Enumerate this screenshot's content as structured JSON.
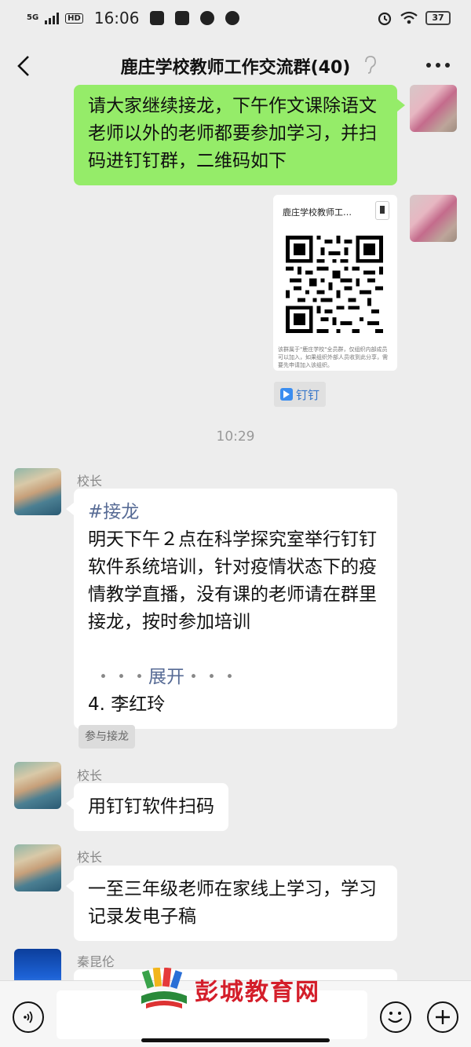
{
  "status_bar": {
    "network": "5G",
    "hd": "HD",
    "time": "16:06",
    "battery": "37"
  },
  "nav": {
    "title": "鹿庄学校教师工作交流群(40)"
  },
  "messages": {
    "m1_text": "请大家继续接龙，下午作文课除语文老师以外的老师都要参加学习，并扫码进钉钉群，二维码如下",
    "card": {
      "title": "鹿庄学校教师工…",
      "note": "该群属于\"鹿庄学校\"全员群，仅组织内部成员可以加入，如果组织外部人员收到此分享，需要先申请加入该组织。"
    },
    "app_tag": "钉钉",
    "time_1029": "10:29",
    "m3_sender": "校长",
    "m3_tag": "#接龙",
    "m3_body": "明天下午２点在科学探究室举行钉钉软件系统培训，针对疫情状态下的疫情教学直播，没有课的老师请在群里接龙，按时参加培训",
    "m3_expand_dots_left": "・・・",
    "m3_expand": "展开",
    "m3_expand_dots_right": "・・・",
    "m3_item": "4.  李红玲",
    "join_btn": "参与接龙",
    "m4_sender": "校长",
    "m4_text": "用钉钉软件扫码",
    "m5_sender": "校长",
    "m5_text": "一至三年级老师在家线上学习，学习记录发电子稿",
    "m6_sender": "秦昆伦"
  },
  "watermark": "彭城教育网",
  "icons": {
    "back": "back-arrow-icon",
    "ear": "ear-icon",
    "more": "more-icon",
    "voice": "voice-icon",
    "emoji": "emoji-icon",
    "plus": "plus-icon"
  }
}
